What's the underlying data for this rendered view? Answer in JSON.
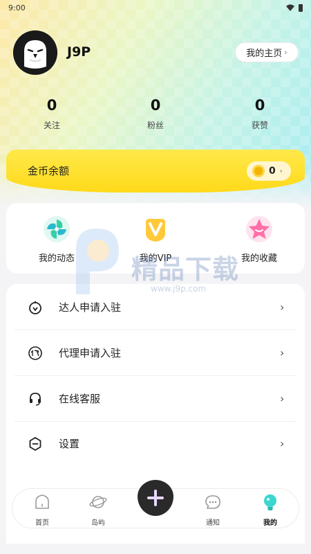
{
  "status_bar": {
    "time": "9:00"
  },
  "profile": {
    "username": "J9P",
    "home_button_label": "我的主页",
    "home_button_chevron": "›"
  },
  "stats": [
    {
      "value": "0",
      "label": "关注"
    },
    {
      "value": "0",
      "label": "粉丝"
    },
    {
      "value": "0",
      "label": "获赞"
    }
  ],
  "gold": {
    "label": "金币余额",
    "amount": "0",
    "chevron": "›"
  },
  "quick_actions": [
    {
      "label": "我的动态",
      "icon": "pinwheel-icon"
    },
    {
      "label": "我的VIP",
      "icon": "vip-icon"
    },
    {
      "label": "我的收藏",
      "icon": "star-icon"
    }
  ],
  "menu": [
    {
      "label": "达人申请入驻",
      "icon": "talent-icon",
      "chevron": "›"
    },
    {
      "label": "代理申请入驻",
      "icon": "agent-icon",
      "chevron": "›"
    },
    {
      "label": "在线客服",
      "icon": "headset-icon",
      "chevron": "›"
    },
    {
      "label": "设置",
      "icon": "settings-icon",
      "chevron": "›"
    }
  ],
  "watermark": {
    "title": "精品下载",
    "url": "www.j9p.com"
  },
  "tabs": [
    {
      "label": "首页",
      "icon": "home-icon"
    },
    {
      "label": "岛屿",
      "icon": "planet-icon"
    },
    {
      "label": "通知",
      "icon": "chat-icon"
    },
    {
      "label": "我的",
      "icon": "user-icon"
    }
  ],
  "colors": {
    "gold_card": "#ffe94a",
    "accent_cyan": "#3ad7d0",
    "fab": "#2a2a2a"
  }
}
